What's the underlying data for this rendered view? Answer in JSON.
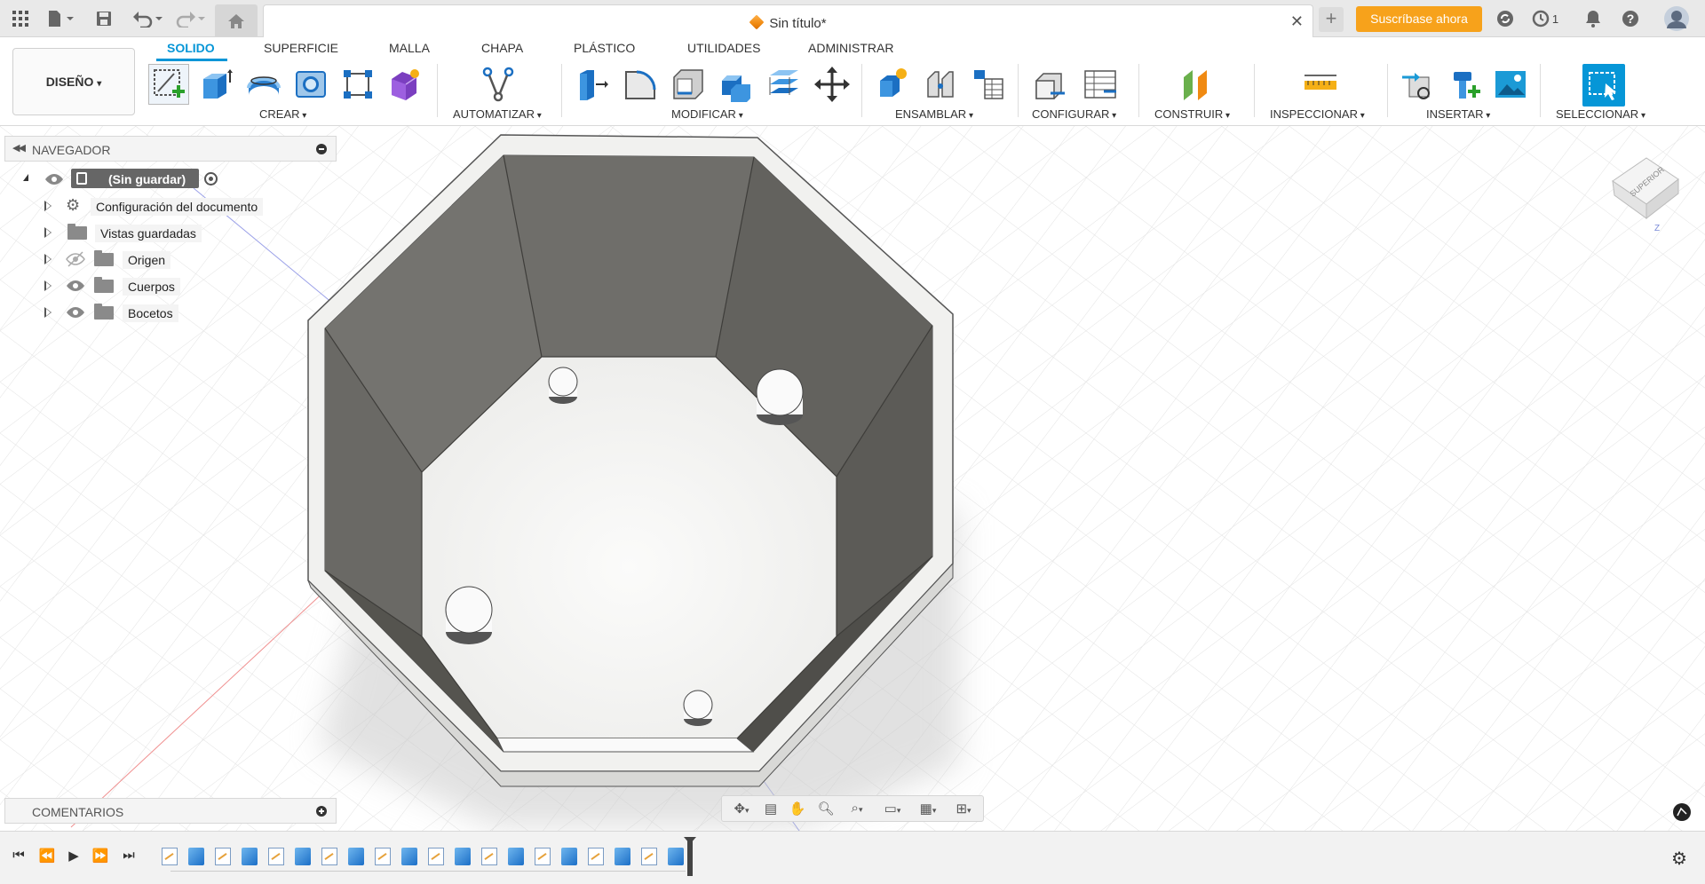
{
  "titlebar": {
    "doc_title": "Sin título*",
    "subscribe_label": "Suscríbase ahora",
    "jobs_count": "1"
  },
  "ribbon": {
    "workspace_label": "DISEÑO",
    "tabs": [
      {
        "label": "SOLIDO",
        "active": true
      },
      {
        "label": "SUPERFICIE",
        "active": false
      },
      {
        "label": "MALLA",
        "active": false
      },
      {
        "label": "CHAPA",
        "active": false
      },
      {
        "label": "PLÁSTICO",
        "active": false
      },
      {
        "label": "UTILIDADES",
        "active": false
      },
      {
        "label": "ADMINISTRAR",
        "active": false
      }
    ],
    "groups": [
      {
        "label": "CREAR"
      },
      {
        "label": "AUTOMATIZAR"
      },
      {
        "label": "MODIFICAR"
      },
      {
        "label": "ENSAMBLAR"
      },
      {
        "label": "CONFIGURAR"
      },
      {
        "label": "CONSTRUIR"
      },
      {
        "label": "INSPECCIONAR"
      },
      {
        "label": "INSERTAR"
      },
      {
        "label": "SELECCIONAR"
      }
    ]
  },
  "navigator": {
    "title": "NAVEGADOR",
    "root_label": "(Sin guardar)",
    "items": [
      {
        "label": "Configuración del documento",
        "icon": "gear-icon"
      },
      {
        "label": "Vistas guardadas",
        "icon": "folder-icon"
      },
      {
        "label": "Origen",
        "icon": "folder-icon",
        "visible": false
      },
      {
        "label": "Cuerpos",
        "icon": "folder-icon",
        "visible": true
      },
      {
        "label": "Bocetos",
        "icon": "folder-icon",
        "visible": true
      }
    ]
  },
  "viewcube": {
    "face_label": "SUPERIOR",
    "axis_label": "Z"
  },
  "comments": {
    "title": "COMENTARIOS"
  },
  "timeline": {
    "features": [
      "sketch",
      "extrude",
      "sketch",
      "extrude",
      "sketch",
      "extrude",
      "sketch",
      "extrude",
      "sketch",
      "extrude",
      "sketch",
      "extrude",
      "sketch",
      "extrude",
      "sketch",
      "extrude",
      "sketch",
      "extrude",
      "sketch",
      "extrude"
    ]
  },
  "colors": {
    "accent": "#0696d7",
    "subscribe": "#f7a21b",
    "model_wall": "#6b6a66",
    "model_floor": "#f7f7f5"
  }
}
